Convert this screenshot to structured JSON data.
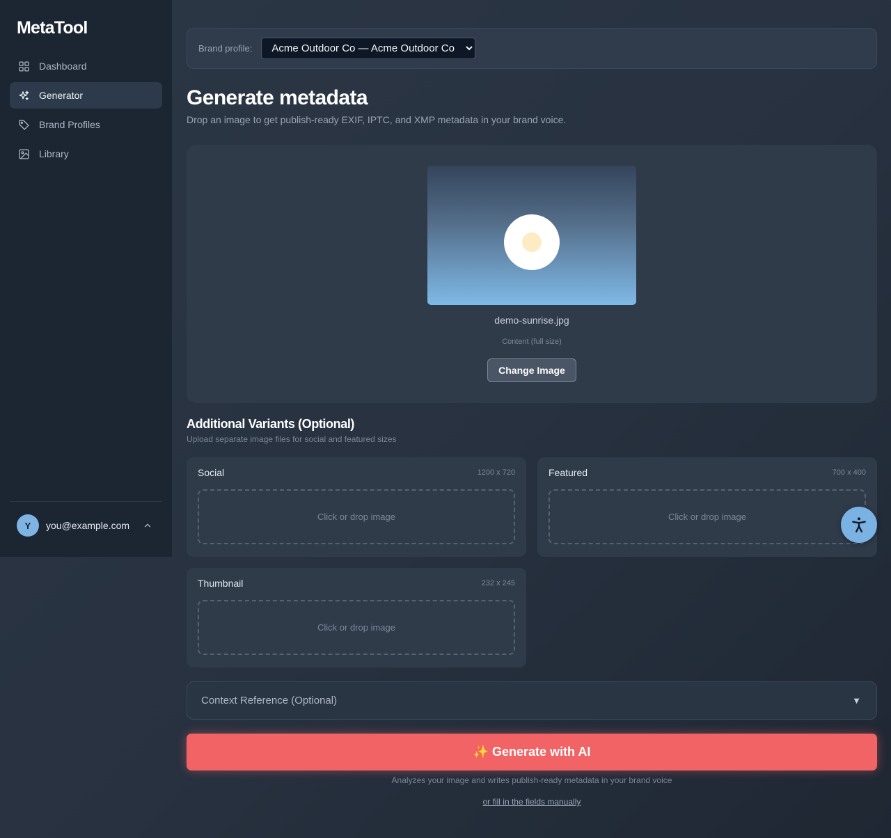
{
  "app": {
    "logo": "MetaTool"
  },
  "sidebar": {
    "items": [
      {
        "label": "Dashboard",
        "icon": "grid-icon",
        "active": false
      },
      {
        "label": "Generator",
        "icon": "sparkle-icon",
        "active": true
      },
      {
        "label": "Brand Profiles",
        "icon": "tag-icon",
        "active": false
      },
      {
        "label": "Library",
        "icon": "image-icon",
        "active": false
      }
    ],
    "user": {
      "initial": "Y",
      "email": "you@example.com"
    }
  },
  "brand": {
    "label": "Brand profile:",
    "selected": "Acme Outdoor Co — Acme Outdoor Co"
  },
  "page": {
    "title": "Generate metadata",
    "subtitle": "Drop an image to get publish-ready EXIF, IPTC, and XMP metadata in your brand voice."
  },
  "upload": {
    "file_name": "demo-sunrise.jpg",
    "content_tag": "Content (full size)",
    "change_label": "Change Image"
  },
  "variants": {
    "title": "Additional Variants (Optional)",
    "subtitle": "Upload separate image files for social and featured sizes",
    "items": [
      {
        "name": "Social",
        "size": "1200 x 720",
        "drop": "Click or drop image"
      },
      {
        "name": "Featured",
        "size": "700 x 400",
        "drop": "Click or drop image"
      },
      {
        "name": "Thumbnail",
        "size": "232 x 245",
        "drop": "Click or drop image"
      }
    ]
  },
  "context": {
    "label": "Context Reference (Optional)",
    "toggle": "▼"
  },
  "generate": {
    "label": "✨ Generate with AI",
    "note": "Analyzes your image and writes publish-ready metadata in your brand voice",
    "manual_link": "or fill in the fields manually"
  },
  "colors": {
    "accent": "#f26365",
    "sidebar_bg": "#1c2532",
    "avatar": "#7fb3e3",
    "a11y_button": "#7ab2e3"
  }
}
